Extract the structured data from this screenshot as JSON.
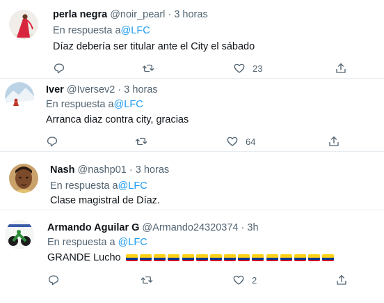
{
  "colors": {
    "accent": "#1d9bf0",
    "text_secondary": "#536471",
    "divider": "#e6ecf0",
    "flag_colombia": [
      "#fcd116",
      "#003893",
      "#ce1126"
    ]
  },
  "tweets": [
    {
      "display_name": "perla negra",
      "handle": "@noir_pearl",
      "separator": "·",
      "time": "3 horas",
      "reply_prefix": "En respuesta a",
      "reply_to": "@LFC",
      "text": "Díaz debería ser titular ante el City el sábado",
      "likes": "23",
      "avatar_icon": "avatar-red-dress-icon"
    },
    {
      "display_name": "Iver",
      "handle": "@Iversev2",
      "separator": "·",
      "time": "3 horas",
      "reply_prefix": "En respuesta a",
      "reply_to": "@LFC",
      "text": "Arranca diaz contra city, gracias",
      "likes": "64",
      "avatar_icon": "avatar-snow-mountain-icon"
    },
    {
      "display_name": "Nash",
      "handle": "@nashp01",
      "separator": "·",
      "time": "3 horas",
      "reply_prefix": "En respuesta a",
      "reply_to": "@LFC",
      "text": "Clase magistral de Díaz.",
      "likes": "",
      "avatar_icon": "avatar-portrait-icon"
    },
    {
      "display_name": "Armando Aguilar G",
      "handle": "@Armando24320374",
      "separator": "·",
      "time": "3h",
      "reply_prefix": "En respuesta a",
      "reply_to": "@LFC",
      "text": "GRANDE Lucho",
      "flag_count": 15,
      "flag_emoji": "colombia-flag-icon",
      "likes": "2",
      "avatar_icon": "avatar-motorcycle-icon"
    }
  ]
}
